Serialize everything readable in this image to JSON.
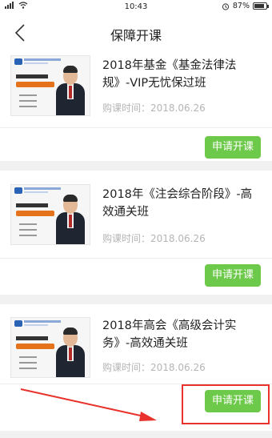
{
  "status_bar": {
    "time": "10:43",
    "battery": "87%",
    "icons": [
      "signal-icon",
      "wifi-icon",
      "alarm-icon",
      "battery-icon"
    ]
  },
  "nav": {
    "title": "保障开课",
    "back_icon": "chevron-left-icon"
  },
  "courses": [
    {
      "title": "2018年基金《基金法律法规》-VIP无忧保过班",
      "date_label": "购课时间：2018.06.26",
      "button_label": "申请开课"
    },
    {
      "title": "2018年《注会综合阶段》-高效通关班",
      "date_label": "购课时间：2018.06.26",
      "button_label": "申请开课"
    },
    {
      "title": "2018年高会《高级会计实务》-高效通关班",
      "date_label": "购课时间：2018.06.26",
      "button_label": "申请开课"
    }
  ],
  "colors": {
    "button_green": "#6cc949",
    "annotation_red": "#e8322b",
    "background": "#f1f1f1"
  }
}
